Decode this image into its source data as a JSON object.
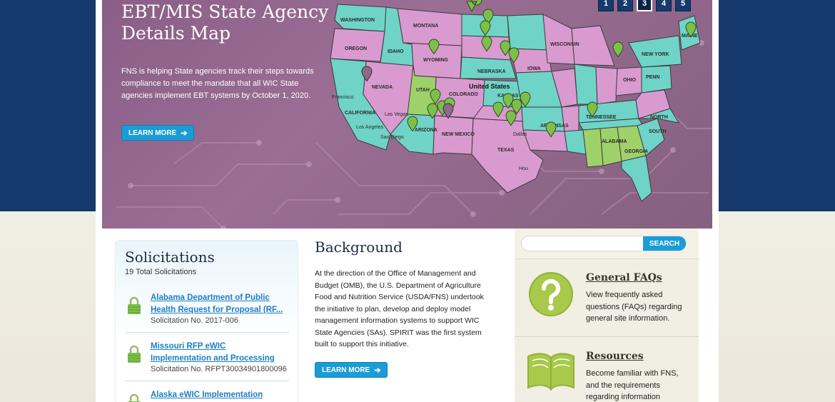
{
  "hero": {
    "title": "EBT/MIS State Agency Details Map",
    "description": "FNS is helping State agencies track their steps towards compliance to meet the mandate that all WIC State agencies implement EBT systems by October 1, 2020.",
    "learn_more_label": "LEARN MORE",
    "pager": [
      "1",
      "2",
      "3",
      "4",
      "5"
    ],
    "active_page": "3",
    "map_labels": {
      "washington": "WASHINGTON",
      "montana": "MONTANA",
      "oregon": "OREGON",
      "idaho": "IDAHO",
      "wyoming": "WYOMING",
      "nevada": "NEVADA",
      "utah": "UTAH",
      "colorado": "COLORADO",
      "california": "CALIFORNIA",
      "arizona": "ARIZONA",
      "new_mexico": "NEW MEXICO",
      "texas": "TEXAS",
      "nebraska": "NEBRASKA",
      "kansas": "KANSAS",
      "iowa": "IOWA",
      "wisconsin": "WISCONSIN",
      "ohio": "OHIO",
      "tennessee": "TENNESSEE",
      "arkansas": "ARKANSAS",
      "alabama": "ALABAMA",
      "georgia": "GEORGIA",
      "south": "SOUTH",
      "north": "NORTH",
      "new_york": "NEW YORK",
      "penn": "PENN",
      "maine": "MAINE",
      "united_states": "United States",
      "francisco": "Francisco",
      "los_angeles": "Los Angeles",
      "las_vegas": "Las Vegas",
      "san_diego": "San Diego",
      "dallas": "Dallas",
      "houston": "Hou"
    }
  },
  "solicitations": {
    "heading": "Solicitations",
    "total": "19 Total Solicitations",
    "items": [
      {
        "title": "Alabama Department of Public Health Request for Proposal (RF...",
        "number": "Solicitation No. 2017-006"
      },
      {
        "title": "Missouri RFP eWIC Implementation and Processing",
        "number": "Solicitation No. RFPT30034901800096"
      },
      {
        "title": "Alaska eWIC Implementation Project",
        "number": ""
      }
    ]
  },
  "background": {
    "heading": "Background",
    "body": "At the direction of the Office of Management and Budget (OMB), the U.S. Department of Agriculture Food and Nutrition Service (USDA/FNS) undertook the initiative to plan, develop and deploy model management information systems to support WIC State Agencies (SAs). SPIRIT was the first system built to support this initiative.",
    "learn_more_label": "LEARN MORE"
  },
  "search": {
    "placeholder": "",
    "button_label": "SEARCH"
  },
  "general_faqs": {
    "title": "General FAQs",
    "description": "View frequently asked questions (FAQs) regarding general site information."
  },
  "resources": {
    "title": "Resources",
    "description": "Become familiar with FNS, and the requirements regarding information"
  },
  "colors": {
    "navy": "#163a6b",
    "accent_blue": "#1a9dd6",
    "hero_purple": "#8a5e86",
    "state_teal": "#6fd3c8",
    "state_pink": "#d99ad0",
    "state_green": "#9fd16a",
    "pin_green": "#7cc04a"
  }
}
